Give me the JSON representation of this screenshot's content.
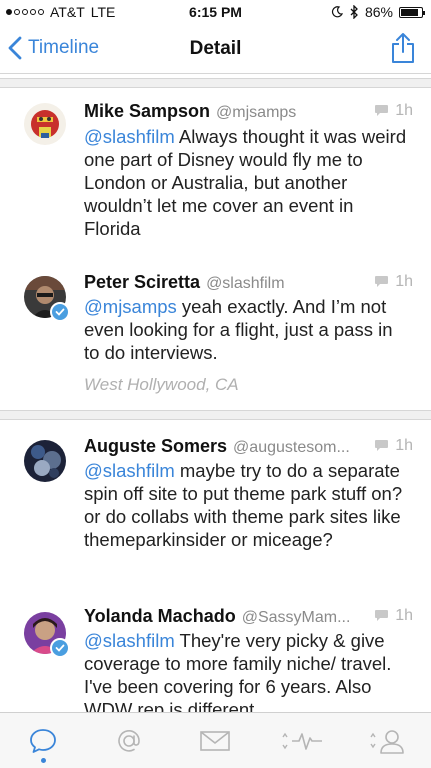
{
  "status_bar": {
    "carrier": "AT&T",
    "network": "LTE",
    "time": "6:15 PM",
    "battery": "86%",
    "battery_level": 0.86
  },
  "nav": {
    "back_label": "Timeline",
    "title": "Detail"
  },
  "tweets": [
    {
      "name": "Mike Sampson",
      "handle": "@mjsamps",
      "time": "1h",
      "mention": "@slashfilm",
      "text": " Always thought it was weird one part of Disney would fly me to London or Australia, but another wouldn’t let me cover an event in Florida"
    },
    {
      "name": "Peter Sciretta",
      "handle": "@slashfilm",
      "time": "1h",
      "mention": "@mjsamps",
      "text": " yeah exactly. And I’m not even looking for a flight, just a pass in to do interviews.",
      "location": "West Hollywood, CA"
    },
    {
      "name": "Auguste Somers",
      "handle": "@augustesom...",
      "time": "1h",
      "mention": "@slashfilm",
      "text": " maybe try to do a separate spin off site to put theme park stuff on? or do collabs with theme park sites like themeparkinsider or miceage?"
    },
    {
      "name": "Yolanda Machado",
      "handle": "@SassyMam...",
      "time": "1h",
      "mention": "@slashfilm",
      "text": " They're very picky & give coverage to more family niche/ travel. I've been covering for 6 years. Also WDW rep is different"
    }
  ],
  "tabs": [
    {
      "icon": "speech-bubble-icon",
      "active": true
    },
    {
      "icon": "at-sign-icon",
      "active": false
    },
    {
      "icon": "envelope-icon",
      "active": false
    },
    {
      "icon": "activity-icon",
      "active": false
    },
    {
      "icon": "profile-icon",
      "active": false
    }
  ],
  "colors": {
    "accent": "#3a85d9",
    "verified": "#4a9ee0"
  }
}
